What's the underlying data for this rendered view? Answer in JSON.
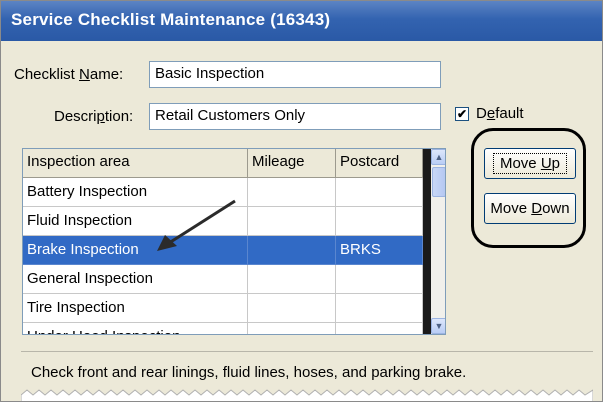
{
  "window": {
    "title": "Service Checklist Maintenance (16343)"
  },
  "form": {
    "name_label_pre": "Checklist ",
    "name_label_u": "N",
    "name_label_post": "ame:",
    "name_value": "Basic Inspection",
    "desc_label_pre": "Descri",
    "desc_label_u": "p",
    "desc_label_post": "tion:",
    "desc_value": "Retail Customers Only",
    "default_label_pre": "D",
    "default_label_u": "e",
    "default_label_post": "fault",
    "default_checked": true
  },
  "grid": {
    "columns": [
      "Inspection area",
      "Mileage",
      "Postcard"
    ],
    "rows": [
      {
        "area": "Battery Inspection",
        "mileage": "",
        "postcard": ""
      },
      {
        "area": "Fluid Inspection",
        "mileage": "",
        "postcard": ""
      },
      {
        "area": "Brake Inspection",
        "mileage": "",
        "postcard": "BRKS"
      },
      {
        "area": "General Inspection",
        "mileage": "",
        "postcard": ""
      },
      {
        "area": "Tire Inspection",
        "mileage": "",
        "postcard": ""
      },
      {
        "area": "Under Hood Inspection",
        "mileage": "",
        "postcard": ""
      }
    ],
    "selected_row": 2
  },
  "buttons": {
    "move_up_pre": "Move ",
    "move_up_u": "U",
    "move_up_post": "p",
    "move_down_pre": "Move ",
    "move_down_u": "D",
    "move_down_post": "own"
  },
  "hint": "Check front and rear linings, fluid lines, hoses, and parking brake.",
  "icons": {
    "checkbox": "check-icon",
    "scroll_up": "scroll-up-arrow-icon",
    "scroll_down": "scroll-down-arrow-icon"
  }
}
